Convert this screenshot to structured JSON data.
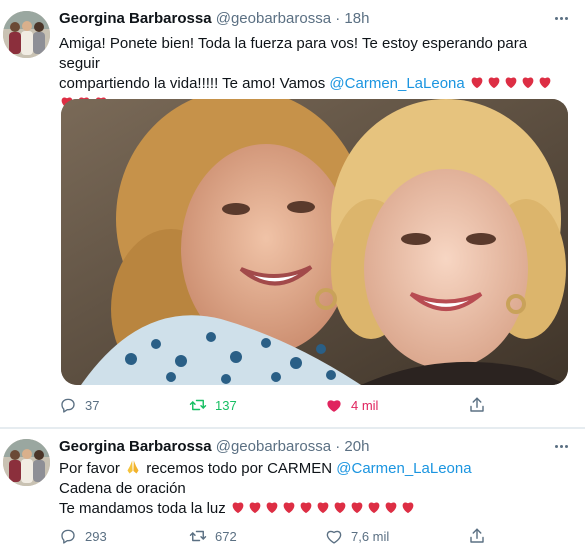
{
  "tweets": [
    {
      "display_name": "Georgina Barbarossa",
      "handle": "@geobarbarossa",
      "separator": "·",
      "time": "18h",
      "text_line1": "Amiga! Ponete bien! Toda la fuerza para vos! Te estoy esperando para seguir",
      "text_line2_prefix": "compartiendo la vida!!!!! Te amo! Vamos ",
      "mention": "@Carmen_LaLeona",
      "hearts_line2": 5,
      "hearts_line3": 3,
      "actions": {
        "replies": "37",
        "retweets": "137",
        "likes": "4 mil"
      },
      "retweeted": true,
      "liked": true
    },
    {
      "display_name": "Georgina Barbarossa",
      "handle": "@geobarbarossa",
      "separator": "·",
      "time": "20h",
      "text_line1_a": "Por favor ",
      "text_line1_b": " recemos todo por CARMEN ",
      "mention": "@Carmen_LaLeona",
      "text_line2": "Cadena de oración",
      "text_line3": "Te mandamos toda la luz ",
      "hearts_line3": 11,
      "actions": {
        "replies": "293",
        "retweets": "672",
        "likes": "7,6 mil"
      },
      "retweeted": false,
      "liked": false
    }
  ],
  "icons": {
    "reply": "reply-icon",
    "retweet": "retweet-icon",
    "like": "heart-icon",
    "share": "share-icon",
    "more": "more-icon",
    "heart_emoji": "red-heart-emoji",
    "pray_emoji": "folded-hands-emoji"
  },
  "colors": {
    "text": "#0f1419",
    "secondary": "#5b7083",
    "mention": "#1b95e0",
    "retweet_active": "#17bf63",
    "like_active": "#e0245e",
    "heart_emoji": "#dd2e44"
  }
}
